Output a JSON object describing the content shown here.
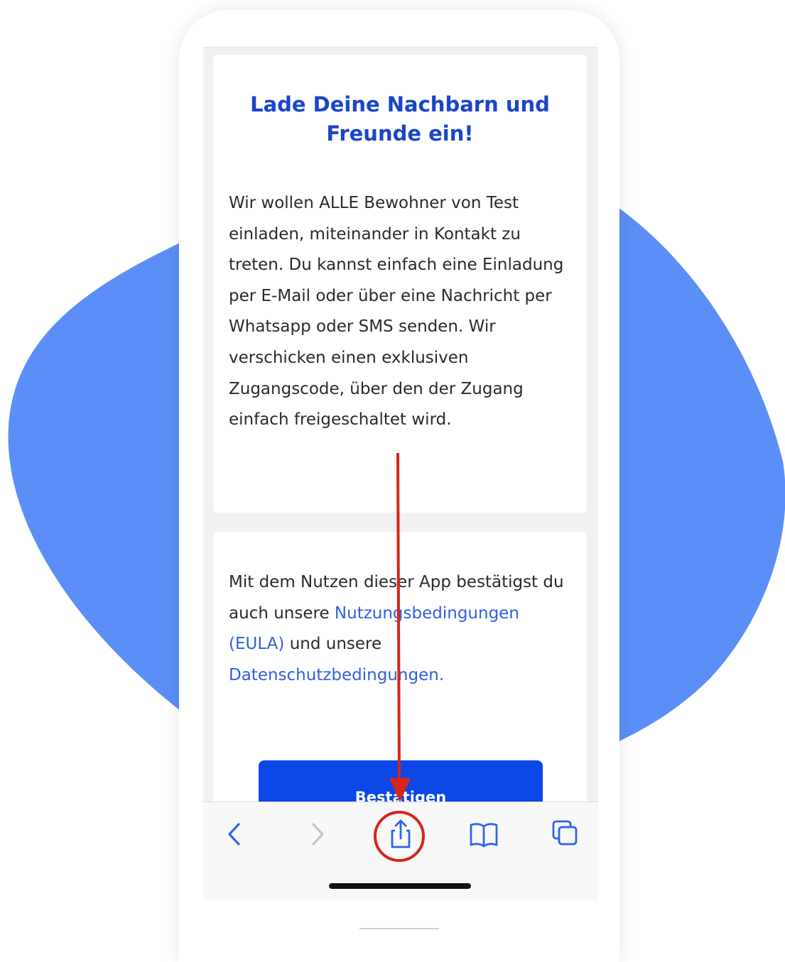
{
  "invite_card": {
    "title": "Lade Deine Nachbarn und Freunde ein!",
    "body": "Wir wollen ALLE Bewohner von Test einladen, miteinander in Kontakt zu treten. Du kannst einfach eine Einladung per E-Mail oder über eine Nachricht per Whatsapp oder SMS senden. Wir verschicken einen exklusiven Zugangscode, über den der Zugang einfach freigeschaltet wird."
  },
  "terms_card": {
    "text_1": "Mit dem Nutzen dieser App bestätigst du auch unsere ",
    "eula_link": "Nutzungsbedingungen (EULA)",
    "text_2": " und unsere ",
    "privacy_link": "Datenschutzbedingungen.",
    "confirm_label": "Bestätigen"
  },
  "toolbar": {
    "icons": [
      "chevron-left-icon",
      "chevron-right-icon",
      "share-icon",
      "bookmarks-icon",
      "tabs-icon"
    ]
  },
  "colors": {
    "background_blob": "#5b8ff7",
    "title": "#1a45c9",
    "link": "#2f5fe0",
    "button": "#0b47e6",
    "annotation": "#d6251c"
  }
}
